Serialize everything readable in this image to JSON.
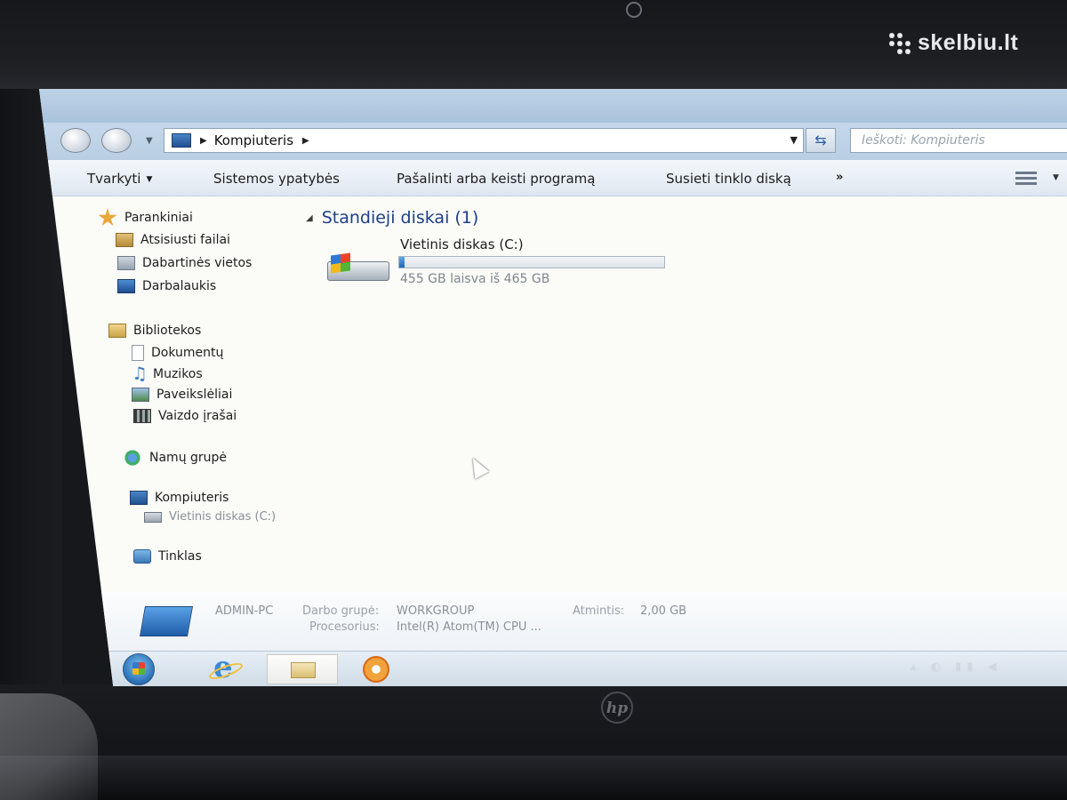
{
  "watermark": "skelbiu.lt",
  "hp_logo": "hp",
  "address": {
    "path": "Kompiuteris",
    "search_placeholder": "Ieškoti: Kompiuteris"
  },
  "toolbar": {
    "organize": "Tvarkyti",
    "system_properties": "Sistemos ypatybės",
    "uninstall": "Pašalinti arba keisti programą",
    "map_drive": "Susieti tinklo diską",
    "more": "»"
  },
  "nav": {
    "favorites": {
      "label": "Parankiniai",
      "items": [
        "Atsisiusti failai",
        "Dabartinės vietos",
        "Darbalaukis"
      ]
    },
    "libraries": {
      "label": "Bibliotekos",
      "items": [
        "Dokumentų",
        "Muzikos",
        "Paveikslėliai",
        "Vaizdo įrašai"
      ]
    },
    "homegroup": "Namų grupė",
    "computer": {
      "label": "Kompiuteris",
      "drive": "Vietinis diskas (C:)"
    },
    "network": "Tinklas"
  },
  "content": {
    "group_title": "Standieji diskai (1)",
    "drive_name": "Vietinis diskas (C:)",
    "drive_free_text": "455 GB laisva iš 465 GB",
    "drive_used_fraction": 0.02
  },
  "details": {
    "pc_name": "ADMIN-PC",
    "workgroup_label": "Darbo grupė:",
    "workgroup_value": "WORKGROUP",
    "memory_label": "Atmintis:",
    "memory_value": "2,00 GB",
    "processor_label": "Procesorius:",
    "processor_value": "Intel(R) Atom(TM) CPU ..."
  },
  "icons": {
    "favorites": "star-icon",
    "downloads": "downloads-folder-icon",
    "recent": "recent-places-icon",
    "desktop": "desktop-icon",
    "libraries": "libraries-icon",
    "documents": "documents-icon",
    "music": "music-icon",
    "pictures": "pictures-icon",
    "videos": "videos-icon",
    "homegroup": "homegroup-icon",
    "computer": "computer-icon",
    "drive": "hard-drive-icon",
    "network": "network-icon"
  },
  "colors": {
    "group_title": "#1e3f86",
    "drive_fill": "#1f65b8",
    "window_chrome": "#b9cee3"
  }
}
